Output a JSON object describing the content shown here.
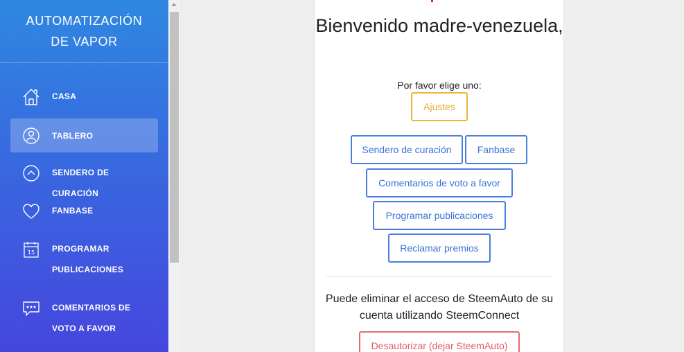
{
  "sidebar": {
    "brand": "AUTOMATIZACIÓN DE VAPOR",
    "items": [
      {
        "label": "CASA",
        "icon": "home-icon"
      },
      {
        "label": "TABLERO",
        "icon": "user-circle-icon",
        "active": true
      },
      {
        "label": "SENDERO DE CURACIÓN",
        "icon": "chevron-up-circle-icon"
      },
      {
        "label": "FANBASE",
        "icon": "heart-icon"
      },
      {
        "label": "PROGRAMAR PUBLICACIONES",
        "icon": "calendar-icon",
        "icon_text": "15"
      },
      {
        "label": "COMENTARIOS DE VOTO A FAVOR",
        "icon": "comment-icon"
      }
    ]
  },
  "main": {
    "welcome": "Bienvenido madre-venezuela,",
    "prompt": "Por favor elige uno:",
    "buttons": {
      "settings": "Ajustes",
      "curation_trail": "Sendero de curación",
      "fanbase": "Fanbase",
      "upvote_comments": "Comentarios de voto a favor",
      "schedule_posts": "Programar publicaciones",
      "claim_rewards": "Reclamar premios"
    },
    "revoke_text": "Puede eliminar el acceso de SteemAuto de su cuenta utilizando SteemConnect",
    "revoke_button": "Desautorizar (dejar SteemAuto)"
  },
  "colors": {
    "sidebar_top": "#2f88e0",
    "sidebar_bottom": "#4646de",
    "primary": "#4a7fe0",
    "warning": "#f0b43a",
    "danger": "#e86b70"
  }
}
